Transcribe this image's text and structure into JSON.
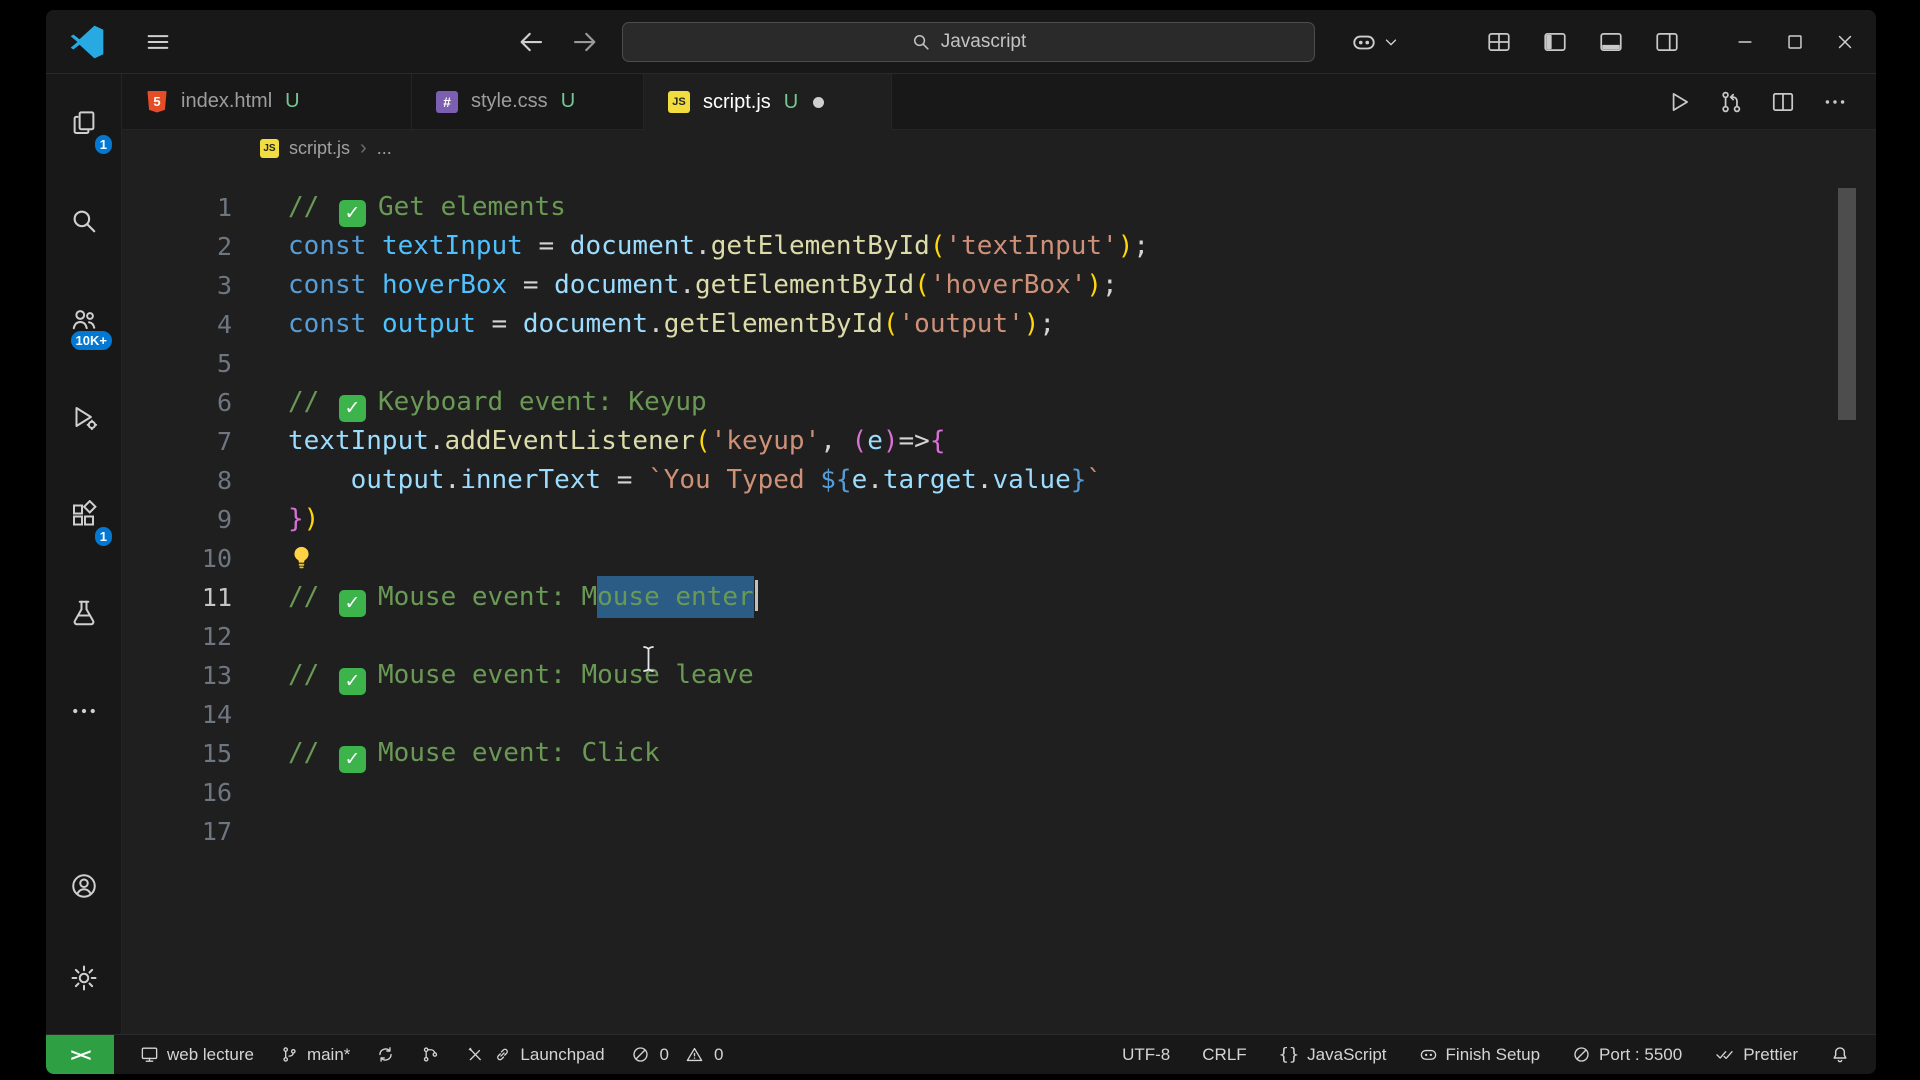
{
  "window": {
    "search_text": "Javascript"
  },
  "tabs": [
    {
      "label": "index.html",
      "git": "U",
      "icon_text": "5"
    },
    {
      "label": "style.css",
      "git": "U",
      "icon_text": "#"
    },
    {
      "label": "script.js",
      "git": "U",
      "icon_text": "JS"
    }
  ],
  "breadcrumb": {
    "icon_text": "JS",
    "file": "script.js",
    "separator": "›",
    "more": "..."
  },
  "activity": {
    "explorer_badge": "1",
    "accounts_badge": "10K+",
    "extensions_badge": "1"
  },
  "editor": {
    "lines": [
      {
        "n": "1",
        "tokens": [
          [
            "cm",
            "// "
          ],
          [
            "chk",
            "✓"
          ],
          [
            "cm",
            "Get elements"
          ]
        ]
      },
      {
        "n": "2",
        "tokens": [
          [
            "kw",
            "const"
          ],
          [
            "pl",
            " "
          ],
          [
            "cv",
            "textInput"
          ],
          [
            "pl",
            " = "
          ],
          [
            "pr",
            "document"
          ],
          [
            "pl",
            "."
          ],
          [
            "fn",
            "getElementById"
          ],
          [
            "b1",
            "("
          ],
          [
            "st",
            "'textInput'"
          ],
          [
            "b1",
            ")"
          ],
          [
            "pl",
            ";"
          ]
        ]
      },
      {
        "n": "3",
        "tokens": [
          [
            "kw",
            "const"
          ],
          [
            "pl",
            " "
          ],
          [
            "cv",
            "hoverBox"
          ],
          [
            "pl",
            " = "
          ],
          [
            "pr",
            "document"
          ],
          [
            "pl",
            "."
          ],
          [
            "fn",
            "getElementById"
          ],
          [
            "b1",
            "("
          ],
          [
            "st",
            "'hoverBox'"
          ],
          [
            "b1",
            ")"
          ],
          [
            "pl",
            ";"
          ]
        ]
      },
      {
        "n": "4",
        "tokens": [
          [
            "kw",
            "const"
          ],
          [
            "pl",
            " "
          ],
          [
            "cv",
            "output"
          ],
          [
            "pl",
            " = "
          ],
          [
            "pr",
            "document"
          ],
          [
            "pl",
            "."
          ],
          [
            "fn",
            "getElementById"
          ],
          [
            "b1",
            "("
          ],
          [
            "st",
            "'output'"
          ],
          [
            "b1",
            ")"
          ],
          [
            "pl",
            ";"
          ]
        ]
      },
      {
        "n": "5",
        "tokens": []
      },
      {
        "n": "6",
        "tokens": [
          [
            "cm",
            "// "
          ],
          [
            "chk",
            "✓"
          ],
          [
            "cm",
            "Keyboard event: Keyup"
          ]
        ]
      },
      {
        "n": "7",
        "tokens": [
          [
            "pr",
            "textInput"
          ],
          [
            "pl",
            "."
          ],
          [
            "fn",
            "addEventListener"
          ],
          [
            "b1",
            "("
          ],
          [
            "st",
            "'keyup'"
          ],
          [
            "pl",
            ", "
          ],
          [
            "b2",
            "("
          ],
          [
            "pr",
            "e"
          ],
          [
            "b2",
            ")"
          ],
          [
            "pl",
            "=>"
          ],
          [
            "b2",
            "{"
          ]
        ]
      },
      {
        "n": "8",
        "tokens": [
          [
            "pl",
            "    "
          ],
          [
            "pr",
            "output"
          ],
          [
            "pl",
            "."
          ],
          [
            "pr",
            "innerText"
          ],
          [
            "pl",
            " = "
          ],
          [
            "st",
            "`You Typed "
          ],
          [
            "tp",
            "${"
          ],
          [
            "pr",
            "e"
          ],
          [
            "pl",
            "."
          ],
          [
            "pr",
            "target"
          ],
          [
            "pl",
            "."
          ],
          [
            "pr",
            "value"
          ],
          [
            "tp",
            "}"
          ],
          [
            "st",
            "`"
          ]
        ]
      },
      {
        "n": "9",
        "tokens": [
          [
            "b2",
            "}"
          ],
          [
            "b1",
            ")"
          ]
        ]
      },
      {
        "n": "10",
        "tokens": [
          [
            "bulb",
            ""
          ]
        ]
      },
      {
        "n": "11",
        "active": true,
        "tokens": [
          [
            "cm",
            "// "
          ],
          [
            "chk",
            "✓"
          ],
          [
            "cm",
            "Mouse event: M"
          ],
          [
            "sel",
            "ouse enter"
          ],
          [
            "cur",
            ""
          ]
        ]
      },
      {
        "n": "12",
        "tokens": []
      },
      {
        "n": "13",
        "tokens": [
          [
            "cm",
            "// "
          ],
          [
            "chk",
            "✓"
          ],
          [
            "cm",
            "Mouse event: Mouse leave"
          ]
        ]
      },
      {
        "n": "14",
        "tokens": []
      },
      {
        "n": "15",
        "tokens": [
          [
            "cm",
            "// "
          ],
          [
            "chk",
            "✓"
          ],
          [
            "cm",
            "Mouse event: Click"
          ]
        ]
      },
      {
        "n": "16",
        "tokens": []
      },
      {
        "n": "17",
        "tokens": []
      }
    ]
  },
  "status": {
    "remote_icon": "><",
    "workspace": "web lecture",
    "branch": "main*",
    "launchpad": "Launchpad",
    "errors": "0",
    "warnings": "0",
    "encoding": "UTF-8",
    "eol": "CRLF",
    "braces": "{}",
    "language": "JavaScript",
    "copilot_status": "Finish Setup",
    "port": "Port : 5500",
    "formatter": "Prettier"
  }
}
